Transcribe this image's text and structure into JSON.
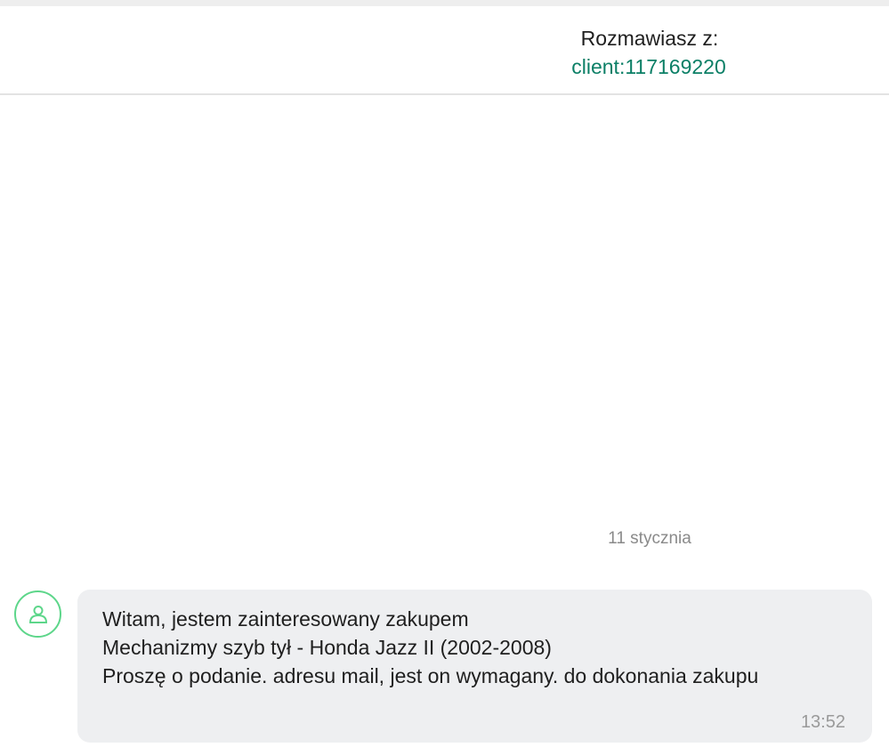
{
  "header": {
    "title": "Rozmawiasz z:",
    "client_link": "client:117169220"
  },
  "chat": {
    "date_separator": "11 stycznia",
    "messages": [
      {
        "sender_icon": "user-icon",
        "lines": [
          "Witam, jestem zainteresowany zakupem",
          "Mechanizmy szyb tył - Honda Jazz II (2002-2008)",
          "Proszę o podanie. adresu mail, jest on wymagany. do dokonania zakupu"
        ],
        "time": "13:52"
      }
    ]
  },
  "colors": {
    "link": "#0b7f66",
    "avatar_ring": "#5dd68a",
    "bubble_bg": "#eeeff1"
  }
}
